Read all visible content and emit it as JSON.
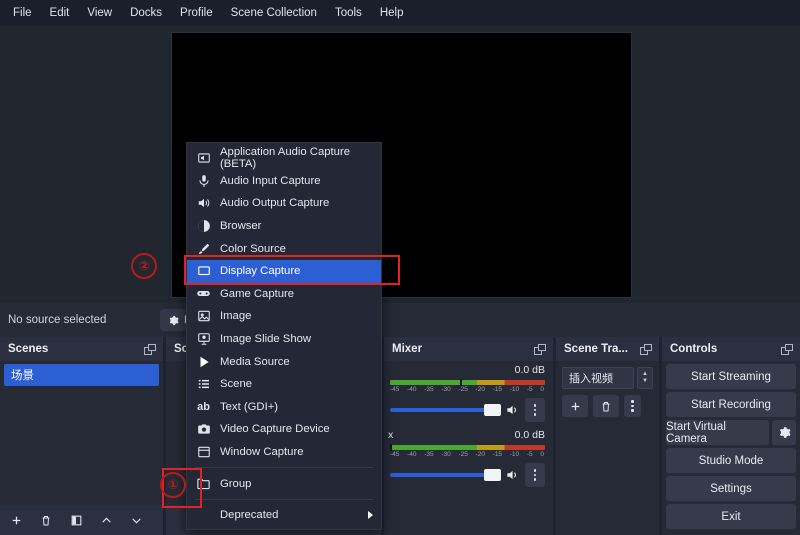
{
  "menubar": {
    "items": [
      {
        "label": "File"
      },
      {
        "label": "Edit"
      },
      {
        "label": "View"
      },
      {
        "label": "Docks"
      },
      {
        "label": "Profile"
      },
      {
        "label": "Scene Collection"
      },
      {
        "label": "Tools"
      },
      {
        "label": "Help"
      }
    ]
  },
  "source_strip": {
    "no_source_text": "No source selected",
    "properties_label": "Pr"
  },
  "context_menu": {
    "items": [
      {
        "label": "Application Audio Capture (BETA)",
        "icon": "app-audio-icon",
        "selected": false,
        "submenu": false
      },
      {
        "label": "Audio Input Capture",
        "icon": "microphone-icon",
        "selected": false,
        "submenu": false
      },
      {
        "label": "Audio Output Capture",
        "icon": "speaker-icon",
        "selected": false,
        "submenu": false
      },
      {
        "label": "Browser",
        "icon": "browser-icon",
        "selected": false,
        "submenu": false
      },
      {
        "label": "Color Source",
        "icon": "paintbrush-icon",
        "selected": false,
        "submenu": false
      },
      {
        "label": "Display Capture",
        "icon": "monitor-icon",
        "selected": true,
        "submenu": false
      },
      {
        "label": "Game Capture",
        "icon": "gamepad-icon",
        "selected": false,
        "submenu": false
      },
      {
        "label": "Image",
        "icon": "image-icon",
        "selected": false,
        "submenu": false
      },
      {
        "label": "Image Slide Show",
        "icon": "slideshow-icon",
        "selected": false,
        "submenu": false
      },
      {
        "label": "Media Source",
        "icon": "play-icon",
        "selected": false,
        "submenu": false
      },
      {
        "label": "Scene",
        "icon": "list-icon",
        "selected": false,
        "submenu": false
      },
      {
        "label": "Text (GDI+)",
        "icon": "text-ab-icon",
        "selected": false,
        "submenu": false
      },
      {
        "label": "Video Capture Device",
        "icon": "camera-icon",
        "selected": false,
        "submenu": false
      },
      {
        "label": "Window Capture",
        "icon": "window-icon",
        "selected": false,
        "submenu": false
      },
      {
        "label": "Group",
        "icon": "folder-icon",
        "selected": false,
        "submenu": false
      },
      {
        "label": "Deprecated",
        "icon": "none",
        "selected": false,
        "submenu": true
      }
    ]
  },
  "scenes_dock": {
    "title": "Scenes",
    "items": [
      {
        "label": "场景",
        "selected": true
      }
    ],
    "toolbar": [
      {
        "icon": "plus-icon",
        "name": "add-scene-button"
      },
      {
        "icon": "trash-icon",
        "name": "remove-scene-button"
      },
      {
        "icon": "filter-icon",
        "name": "scene-filters-button"
      },
      {
        "icon": "chevron-up-icon",
        "name": "move-scene-up-button"
      },
      {
        "icon": "chevron-down-icon",
        "name": "move-scene-down-button"
      }
    ]
  },
  "sources_dock": {
    "title": "Sou",
    "toolbar": [
      {
        "icon": "plus-icon",
        "name": "add-source-button"
      }
    ]
  },
  "mixer_dock": {
    "title": "Mixer",
    "tick_labels": [
      "-45",
      "-40",
      "-35",
      "-30",
      "-25",
      "-20",
      "-15",
      "-10",
      "-5",
      "0"
    ],
    "tracks": [
      {
        "name": "",
        "db": "0.0 dB",
        "level_pct": 88,
        "fader_pct": 88
      },
      {
        "name": "x",
        "db": "0.0 dB",
        "level_pct": 78,
        "fader_pct": 88
      }
    ]
  },
  "transitions_dock": {
    "title": "Scene Tra...",
    "selected_transition": "插入视频",
    "toolbar": [
      {
        "icon": "plus-icon",
        "name": "add-transition-button"
      },
      {
        "icon": "trash-icon",
        "name": "remove-transition-button"
      },
      {
        "icon": "kebab-icon",
        "name": "transition-properties-button"
      }
    ]
  },
  "controls_dock": {
    "title": "Controls",
    "buttons": [
      {
        "label": "Start Streaming",
        "name": "start-streaming-button"
      },
      {
        "label": "Start Recording",
        "name": "start-recording-button"
      },
      {
        "label": "Start Virtual Camera",
        "name": "start-virtual-camera-button",
        "has_gear": true
      },
      {
        "label": "Studio Mode",
        "name": "studio-mode-button"
      },
      {
        "label": "Settings",
        "name": "settings-button"
      },
      {
        "label": "Exit",
        "name": "exit-button"
      }
    ]
  },
  "annotations": [
    {
      "label": "①",
      "name": "annotation-step-1"
    },
    {
      "label": "②",
      "name": "annotation-step-2"
    }
  ],
  "colors": {
    "accent_blue": "#2c5fd4",
    "annotation_red": "#b51c1c",
    "highlight_box_red": "#e02424",
    "panel_bg": "#252a36",
    "header_bg": "#2b3040"
  }
}
